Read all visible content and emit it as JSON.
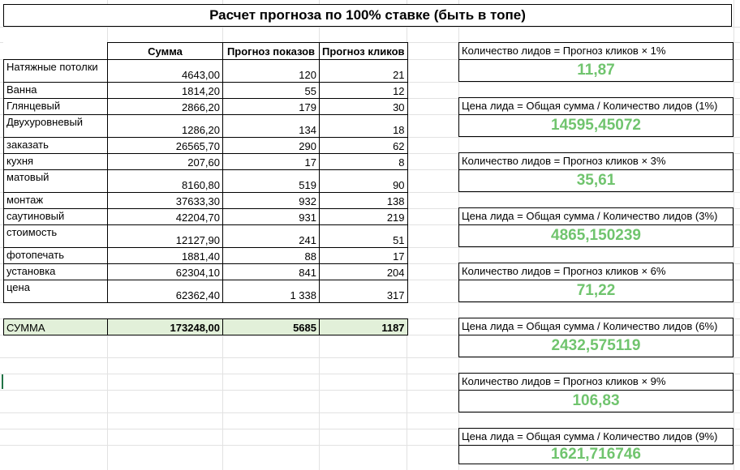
{
  "title": "Расчет прогноза по 100% ставке (быть в топе)",
  "table": {
    "headers": [
      "Сумма",
      "Прогноз показов",
      "Прогноз кликов"
    ],
    "rows": [
      {
        "name": "Натяжные потолки",
        "sum": "4643,00",
        "impr": "120",
        "clicks": "21"
      },
      {
        "name": "Ванна",
        "sum": "1814,20",
        "impr": "55",
        "clicks": "12"
      },
      {
        "name": "Глянцевый",
        "sum": "2866,20",
        "impr": "179",
        "clicks": "30"
      },
      {
        "name": "Двухуровневый",
        "sum": "1286,20",
        "impr": "134",
        "clicks": "18"
      },
      {
        "name": "заказать",
        "sum": "26565,70",
        "impr": "290",
        "clicks": "62"
      },
      {
        "name": "кухня",
        "sum": "207,60",
        "impr": "17",
        "clicks": "8"
      },
      {
        "name": "матовый",
        "sum": "8160,80",
        "impr": "519",
        "clicks": "90"
      },
      {
        "name": "монтаж",
        "sum": "37633,30",
        "impr": "932",
        "clicks": "138"
      },
      {
        "name": "саутиновый",
        "sum": "42204,70",
        "impr": "931",
        "clicks": "219"
      },
      {
        "name": "стоимость",
        "sum": "12127,90",
        "impr": "241",
        "clicks": "51"
      },
      {
        "name": "фотопечать",
        "sum": "1881,40",
        "impr": "88",
        "clicks": "17"
      },
      {
        "name": "установка",
        "sum": "62304,10",
        "impr": "841",
        "clicks": "204"
      },
      {
        "name": "цена",
        "sum": "62362,40",
        "impr": "1 338",
        "clicks": "317"
      }
    ],
    "total": {
      "name": "СУММА",
      "sum": "173248,00",
      "impr": "5685",
      "clicks": "1187"
    }
  },
  "boxes": [
    {
      "label": "Количество лидов = Прогноз кликов × 1%",
      "value": "11,87"
    },
    {
      "label": "Цена лида = Общая сумма / Количество лидов (1%)",
      "value": "14595,45072"
    },
    {
      "label": "Количество лидов = Прогноз кликов × 3%",
      "value": "35,61"
    },
    {
      "label": "Цена лида = Общая сумма / Количество лидов (3%)",
      "value": "4865,150239"
    },
    {
      "label": "Количество лидов = Прогноз кликов × 6%",
      "value": "71,22"
    },
    {
      "label": "Цена лида = Общая сумма / Количество лидов (6%)",
      "value": "2432,575119"
    },
    {
      "label": "Количество лидов = Прогноз кликов × 9%",
      "value": "106,83"
    },
    {
      "label": "Цена лида = Общая сумма / Количество лидов (9%)",
      "value": "1621,716746"
    }
  ],
  "colors": {
    "accent_green": "#70c46e",
    "sum_row_bg": "#e2f0d9"
  }
}
